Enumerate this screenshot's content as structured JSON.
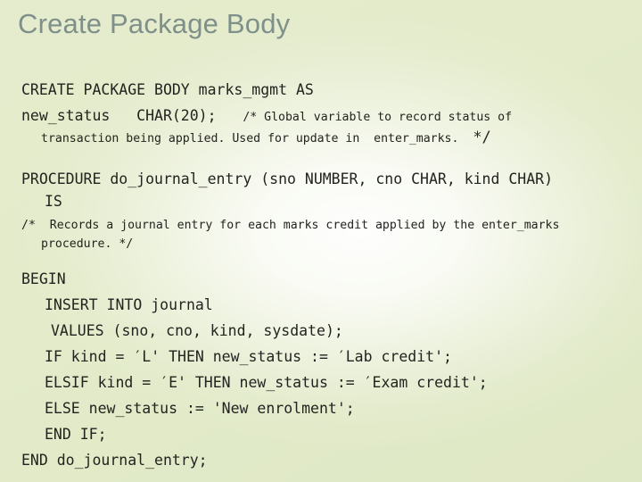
{
  "slide": {
    "title": "Create Package Body",
    "title_color": "#7e9089",
    "background_edge_color": "#dfe8c5",
    "background_center_color": "#ffffff",
    "code_text_color": "#23231f"
  },
  "code": {
    "line_1": "CREATE PACKAGE BODY marks_mgmt AS",
    "line_2_code": "new_status   CHAR(20);   ",
    "line_2_comment": "/* Global variable to record status of",
    "line_3_comment": "transaction being applied. Used for update in  enter_marks.  ",
    "line_3_comment_end": "*/",
    "line_4": "PROCEDURE do_journal_entry (sno NUMBER, cno CHAR, kind CHAR)",
    "line_5": "IS",
    "line_6_comment": "/*  Records a journal entry for each marks credit applied by the enter_marks",
    "line_7_comment": "procedure. */",
    "line_8": "BEGIN",
    "line_9": "INSERT INTO journal",
    "line_10": "VALUES (sno, cno, kind, sysdate);",
    "line_11": "IF kind = ′L' THEN new_status := ′Lab credit';",
    "line_12": "ELSIF kind = ′E' THEN new_status := ′Exam credit';",
    "line_13": "ELSE new_status := 'New enrolment';",
    "line_14": "END IF;",
    "line_15": "END do_journal_entry;"
  }
}
